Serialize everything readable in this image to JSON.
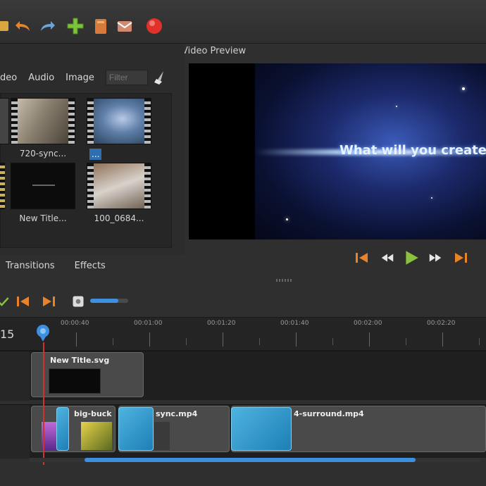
{
  "toolbar": {
    "buttons": [
      "undo-icon",
      "redo-icon",
      "add-track-icon",
      "export-icon",
      "import-icon",
      "record-icon"
    ]
  },
  "preview_panel": {
    "title": "Video Preview",
    "overlay_text": "What will you create?"
  },
  "files": {
    "tabs": [
      "deo",
      "Audio",
      "Image"
    ],
    "filter_placeholder": "Filter",
    "items": [
      {
        "caption": "720-sync..."
      },
      {
        "caption": "...",
        "selected": true
      },
      {
        "caption": "New Title..."
      },
      {
        "caption": "100_0684..."
      }
    ]
  },
  "bottom_tabs": [
    "Transitions",
    "Effects"
  ],
  "timeline": {
    "timecode": "15",
    "ruler_labels": [
      "00:00:40",
      "00:01:00",
      "00:01:20",
      "00:01:40",
      "00:02:00",
      "00:02:20"
    ],
    "clips": {
      "title_clip": "New Title.svg",
      "video_clip_1": "big-buck",
      "video_clip_2": "sync.mp4",
      "video_clip_3": "4-surround.mp4"
    }
  },
  "colors": {
    "accent": "#3d8fe0",
    "record": "#e0322b",
    "control_orange": "#e8832a",
    "play_green": "#8bc23d"
  }
}
